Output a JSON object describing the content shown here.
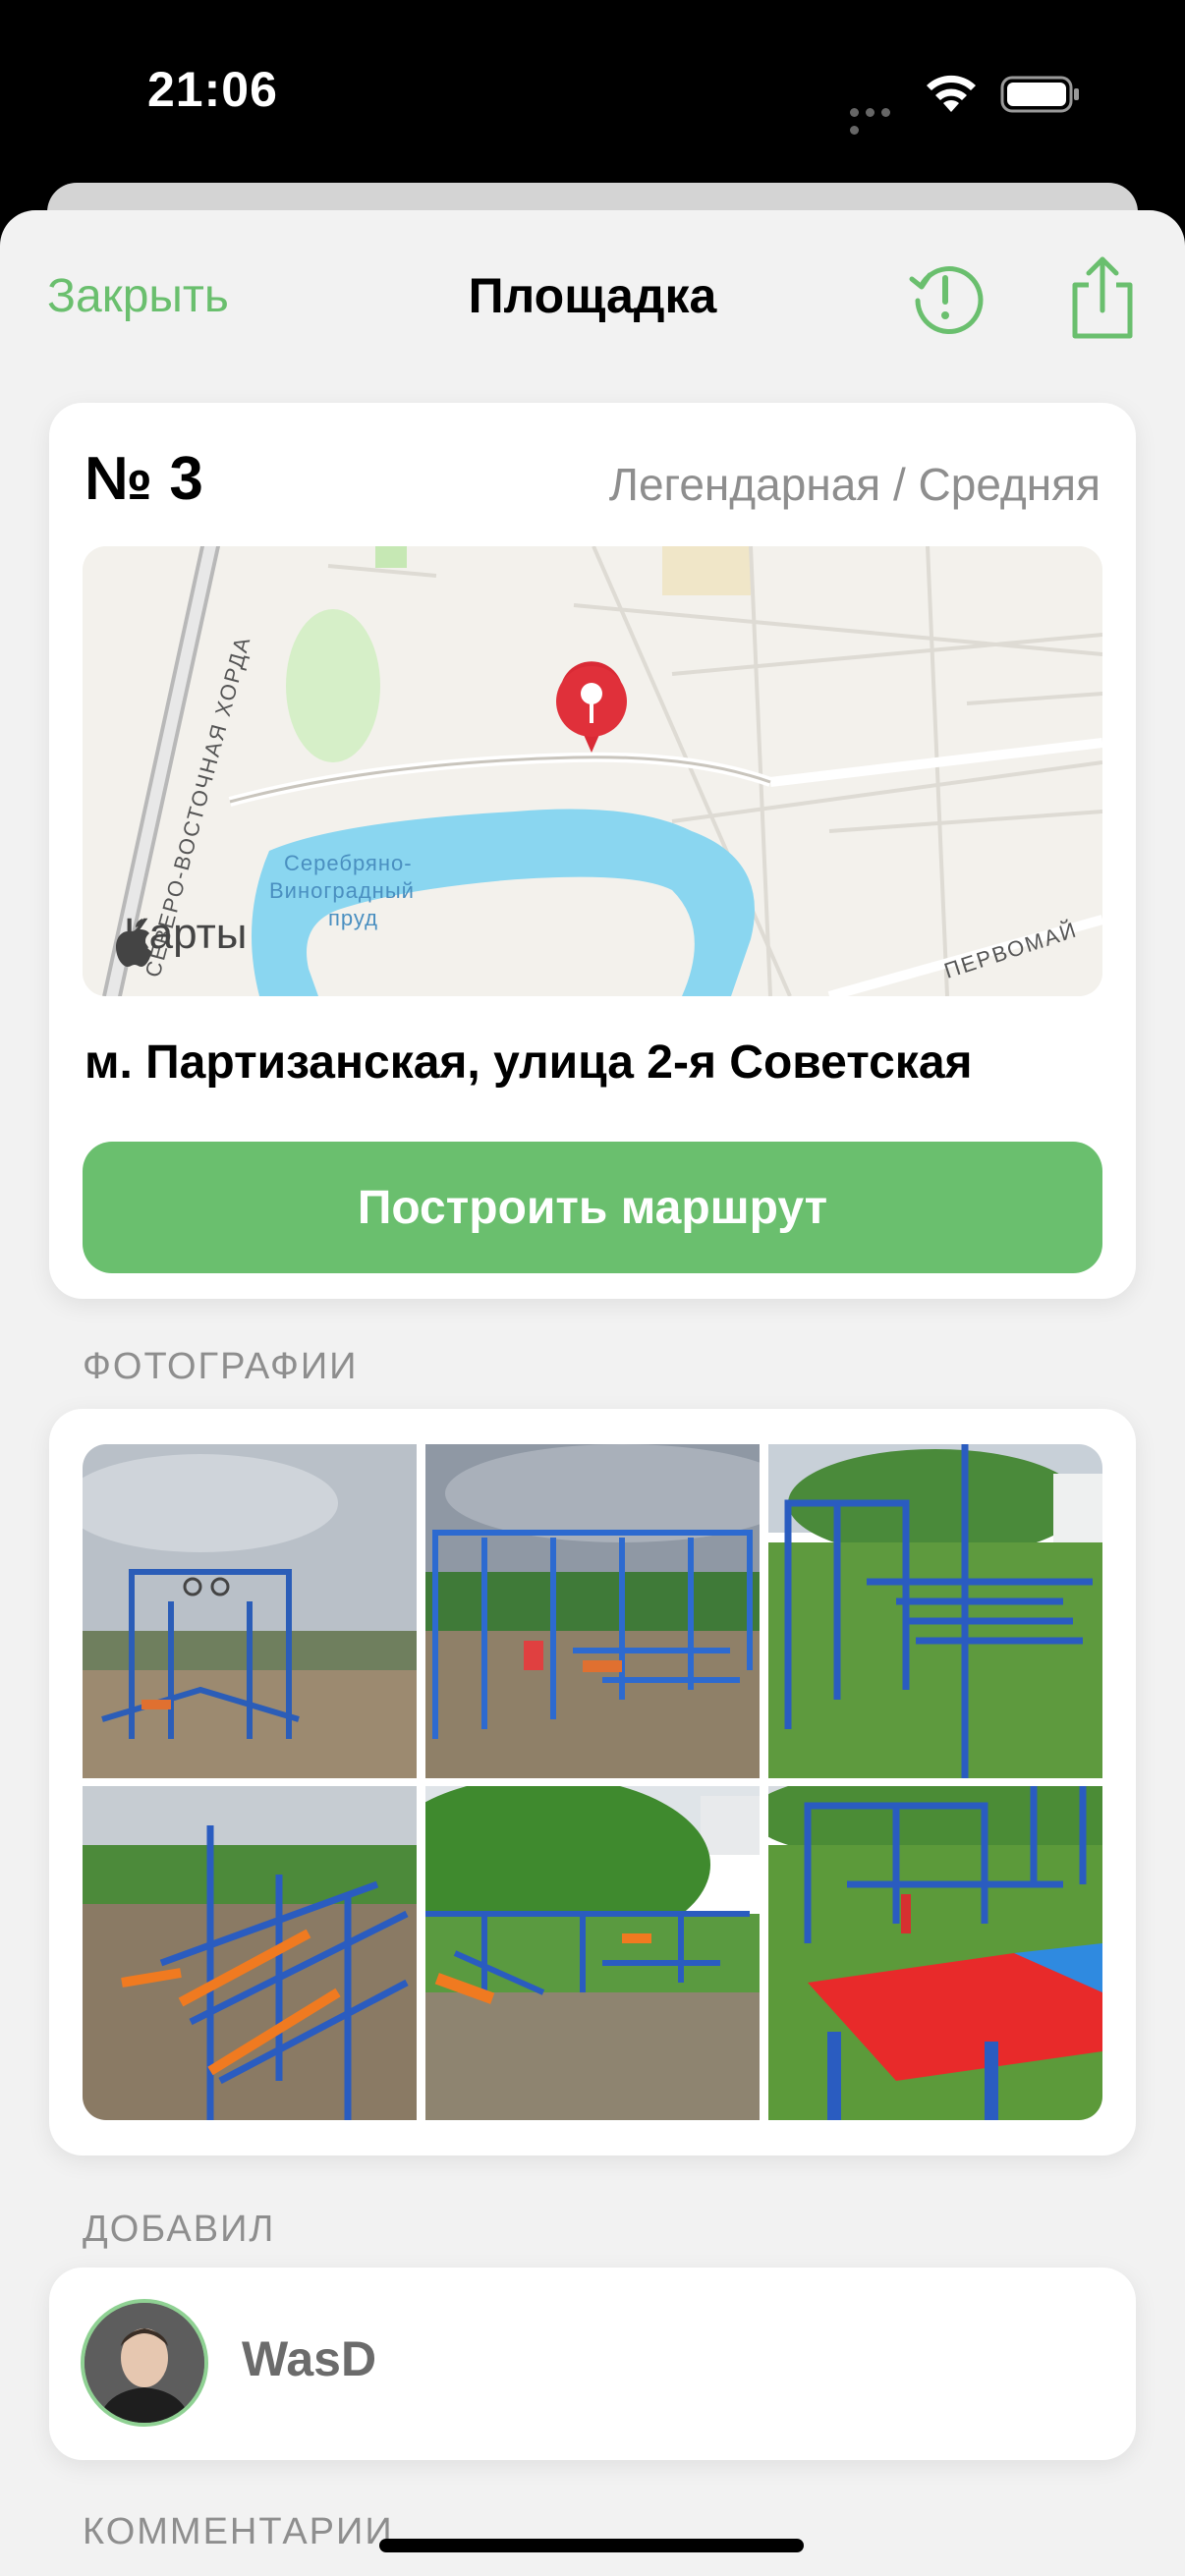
{
  "status_bar": {
    "time": "21:06"
  },
  "nav": {
    "close_label": "Закрыть",
    "title": "Площадка",
    "report_icon": "exclamation-history-icon",
    "share_icon": "share-icon"
  },
  "ground": {
    "number": "№ 3",
    "level": "Легендарная / Средняя",
    "address": "м. Партизанская, улица 2-я Советская",
    "route_label": "Построить маршрут",
    "map": {
      "brand": "Карты",
      "labels": {
        "road1": "СЕВЕРО-ВОСТОЧНАЯ ХОРДА",
        "pond": [
          "Серебряно-",
          "Виноградный",
          "пруд"
        ],
        "road2": "ПЕРВОМАЙ"
      }
    }
  },
  "sections": {
    "photos": "ФОТОГРАФИИ",
    "author": "ДОБАВИЛ",
    "comments": "КОММЕНТАРИИ"
  },
  "author": {
    "name": "WasD"
  },
  "colors": {
    "accent": "#6abf6e",
    "secondary": "#8e8e8e",
    "pin": "#e0303a",
    "water": "#8ad6f0"
  }
}
